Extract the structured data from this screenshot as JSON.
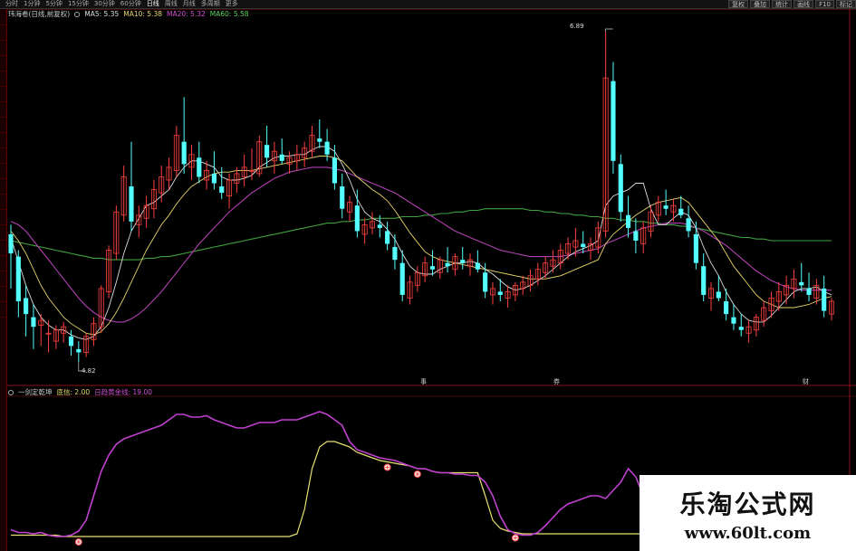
{
  "toolbar": {
    "period_tabs": [
      "分时",
      "1分钟",
      "5分钟",
      "15分钟",
      "30分钟",
      "60分钟",
      "日线",
      "周线",
      "月线",
      "多周期",
      "更多"
    ],
    "active_tab": "日线",
    "right_tabs": [
      "复权",
      "叠加",
      "统计",
      "画线",
      "F10",
      "标记"
    ]
  },
  "main_panel": {
    "stock_name": "玮海卷(日线,前复权)",
    "ma_labels": [
      {
        "text": "MA5: 5.35",
        "color": "#dddddd"
      },
      {
        "text": "MA10: 5.38",
        "color": "#e6d36a"
      },
      {
        "text": "MA20: 5.32",
        "color": "#d050d0"
      },
      {
        "text": "MA60: 5.58",
        "color": "#5fcf5f"
      }
    ],
    "high_label": "6.89",
    "low_label": "4.82"
  },
  "events": [
    "事",
    "券",
    "财"
  ],
  "indicator_panel": {
    "name": "一剑定乾坤",
    "params": "底信: 2.00",
    "line_label": "日趋黄金线: 19.00"
  },
  "watermark": {
    "title": "乐淘公式网",
    "url": "www.60lt.com"
  },
  "colors": {
    "up": "#ff4040",
    "down": "#54ffff",
    "ma5": "#dddddd",
    "ma10": "#e6d36a",
    "ma20": "#b040b0",
    "ma60": "#40a040",
    "ind_purple": "#c040d0",
    "ind_yellow": "#e8e070",
    "divider": "#8b1010"
  },
  "chart_data": {
    "type": "candlestick",
    "price_range": [
      4.82,
      6.89
    ],
    "candles": [
      [
        5.62,
        5.68,
        5.28,
        5.5
      ],
      [
        5.48,
        5.52,
        5.1,
        5.2
      ],
      [
        5.22,
        5.3,
        4.98,
        5.12
      ],
      [
        5.1,
        5.18,
        4.9,
        5.04
      ],
      [
        5.05,
        5.12,
        4.92,
        5.08
      ],
      [
        5.0,
        5.08,
        4.88,
        5.0
      ],
      [
        4.95,
        5.05,
        4.9,
        5.02
      ],
      [
        5.0,
        5.07,
        4.94,
        5.04
      ],
      [
        4.98,
        5.02,
        4.86,
        4.92
      ],
      [
        4.9,
        4.95,
        4.82,
        4.88
      ],
      [
        4.88,
        5.0,
        4.85,
        4.98
      ],
      [
        4.96,
        5.1,
        4.92,
        5.06
      ],
      [
        5.04,
        5.3,
        5.0,
        5.28
      ],
      [
        5.26,
        5.55,
        5.22,
        5.52
      ],
      [
        5.5,
        5.8,
        5.46,
        5.76
      ],
      [
        5.74,
        6.05,
        5.7,
        5.98
      ],
      [
        5.92,
        6.2,
        5.64,
        5.7
      ],
      [
        5.68,
        5.8,
        5.6,
        5.74
      ],
      [
        5.72,
        5.86,
        5.66,
        5.8
      ],
      [
        5.78,
        5.96,
        5.72,
        5.9
      ],
      [
        5.88,
        6.05,
        5.82,
        5.98
      ],
      [
        5.96,
        6.1,
        5.9,
        6.04
      ],
      [
        6.02,
        6.3,
        5.98,
        6.24
      ],
      [
        6.2,
        6.48,
        6.0,
        6.06
      ],
      [
        6.04,
        6.18,
        5.96,
        6.12
      ],
      [
        6.1,
        6.2,
        5.94,
        5.98
      ],
      [
        5.96,
        6.08,
        5.9,
        6.02
      ],
      [
        6.0,
        6.14,
        5.9,
        5.94
      ],
      [
        5.92,
        6.04,
        5.84,
        5.88
      ],
      [
        5.86,
        6.0,
        5.78,
        5.96
      ],
      [
        5.94,
        6.04,
        5.88,
        6.0
      ],
      [
        5.98,
        6.12,
        5.92,
        6.04
      ],
      [
        6.02,
        6.16,
        5.96,
        6.02
      ],
      [
        6.0,
        6.24,
        5.98,
        6.2
      ],
      [
        6.18,
        6.3,
        6.04,
        6.1
      ],
      [
        6.08,
        6.2,
        6.0,
        6.14
      ],
      [
        6.12,
        6.22,
        6.06,
        6.08
      ],
      [
        6.06,
        6.14,
        6.0,
        6.1
      ],
      [
        6.08,
        6.18,
        6.02,
        6.12
      ],
      [
        6.1,
        6.2,
        6.04,
        6.16
      ],
      [
        6.14,
        6.3,
        6.1,
        6.24
      ],
      [
        6.22,
        6.34,
        6.16,
        6.2
      ],
      [
        6.2,
        6.28,
        6.08,
        6.12
      ],
      [
        6.1,
        6.18,
        5.9,
        5.94
      ],
      [
        5.92,
        6.0,
        5.72,
        5.78
      ],
      [
        5.76,
        5.86,
        5.7,
        5.82
      ],
      [
        5.8,
        5.9,
        5.6,
        5.64
      ],
      [
        5.62,
        5.72,
        5.56,
        5.68
      ],
      [
        5.66,
        5.76,
        5.62,
        5.7
      ],
      [
        5.68,
        5.74,
        5.6,
        5.66
      ],
      [
        5.64,
        5.7,
        5.52,
        5.56
      ],
      [
        5.54,
        5.62,
        5.4,
        5.46
      ],
      [
        5.44,
        5.52,
        5.2,
        5.24
      ],
      [
        5.22,
        5.36,
        5.18,
        5.32
      ],
      [
        5.3,
        5.42,
        5.26,
        5.38
      ],
      [
        5.36,
        5.48,
        5.32,
        5.44
      ],
      [
        5.42,
        5.52,
        5.36,
        5.4
      ],
      [
        5.38,
        5.48,
        5.34,
        5.46
      ],
      [
        5.44,
        5.54,
        5.38,
        5.42
      ],
      [
        5.4,
        5.5,
        5.36,
        5.48
      ],
      [
        5.46,
        5.54,
        5.4,
        5.44
      ],
      [
        5.42,
        5.5,
        5.36,
        5.46
      ],
      [
        5.44,
        5.52,
        5.38,
        5.4
      ],
      [
        5.38,
        5.44,
        5.22,
        5.26
      ],
      [
        5.24,
        5.32,
        5.18,
        5.28
      ],
      [
        5.26,
        5.34,
        5.2,
        5.24
      ],
      [
        5.22,
        5.3,
        5.16,
        5.26
      ],
      [
        5.24,
        5.32,
        5.2,
        5.3
      ],
      [
        5.28,
        5.36,
        5.24,
        5.32
      ],
      [
        5.3,
        5.4,
        5.26,
        5.36
      ],
      [
        5.34,
        5.44,
        5.3,
        5.4
      ],
      [
        5.38,
        5.48,
        5.34,
        5.44
      ],
      [
        5.42,
        5.52,
        5.38,
        5.46
      ],
      [
        5.44,
        5.56,
        5.4,
        5.52
      ],
      [
        5.5,
        5.6,
        5.46,
        5.56
      ],
      [
        5.54,
        5.66,
        5.48,
        5.58
      ],
      [
        5.56,
        5.64,
        5.5,
        5.54
      ],
      [
        5.52,
        5.6,
        5.46,
        5.56
      ],
      [
        5.54,
        5.7,
        5.5,
        5.66
      ],
      [
        5.64,
        6.89,
        5.6,
        6.6
      ],
      [
        6.58,
        6.7,
        6.0,
        6.08
      ],
      [
        6.06,
        6.12,
        5.7,
        5.76
      ],
      [
        5.74,
        5.86,
        5.6,
        5.66
      ],
      [
        5.64,
        5.72,
        5.5,
        5.58
      ],
      [
        5.56,
        5.7,
        5.5,
        5.66
      ],
      [
        5.64,
        5.8,
        5.6,
        5.76
      ],
      [
        5.74,
        5.86,
        5.7,
        5.82
      ],
      [
        5.8,
        5.9,
        5.74,
        5.78
      ],
      [
        5.76,
        5.84,
        5.7,
        5.8
      ],
      [
        5.78,
        5.86,
        5.72,
        5.74
      ],
      [
        5.72,
        5.8,
        5.6,
        5.64
      ],
      [
        5.62,
        5.7,
        5.4,
        5.44
      ],
      [
        5.42,
        5.5,
        5.2,
        5.24
      ],
      [
        5.22,
        5.32,
        5.14,
        5.28
      ],
      [
        5.26,
        5.36,
        5.2,
        5.22
      ],
      [
        5.2,
        5.28,
        5.08,
        5.12
      ],
      [
        5.1,
        5.18,
        5.02,
        5.06
      ],
      [
        5.04,
        5.12,
        4.98,
        5.02
      ],
      [
        5.0,
        5.08,
        4.94,
        5.04
      ],
      [
        5.02,
        5.12,
        4.98,
        5.1
      ],
      [
        5.08,
        5.2,
        5.04,
        5.16
      ],
      [
        5.14,
        5.26,
        5.1,
        5.22
      ],
      [
        5.2,
        5.32,
        5.14,
        5.26
      ],
      [
        5.24,
        5.36,
        5.18,
        5.3
      ],
      [
        5.28,
        5.4,
        5.22,
        5.34
      ],
      [
        5.32,
        5.44,
        5.26,
        5.3
      ],
      [
        5.28,
        5.38,
        5.2,
        5.24
      ],
      [
        5.22,
        5.34,
        5.18,
        5.3
      ],
      [
        5.28,
        5.36,
        5.1,
        5.14
      ],
      [
        5.12,
        5.22,
        5.08,
        5.2
      ]
    ],
    "ma5": [
      5.6,
      5.45,
      5.3,
      5.18,
      5.1,
      5.05,
      5.02,
      5.02,
      4.99,
      4.97,
      4.96,
      4.98,
      5.04,
      5.16,
      5.32,
      5.5,
      5.64,
      5.72,
      5.8,
      5.82,
      5.86,
      5.9,
      5.98,
      6.04,
      6.08,
      6.08,
      6.06,
      6.04,
      5.98,
      5.96,
      5.96,
      5.97,
      5.99,
      6.04,
      6.07,
      6.1,
      6.11,
      6.11,
      6.12,
      6.12,
      6.15,
      6.17,
      6.17,
      6.14,
      6.06,
      5.96,
      5.84,
      5.76,
      5.72,
      5.7,
      5.65,
      5.59,
      5.5,
      5.42,
      5.38,
      5.37,
      5.37,
      5.4,
      5.42,
      5.44,
      5.44,
      5.45,
      5.44,
      5.4,
      5.37,
      5.33,
      5.29,
      5.27,
      5.28,
      5.3,
      5.33,
      5.36,
      5.4,
      5.44,
      5.48,
      5.51,
      5.53,
      5.55,
      5.58,
      5.8,
      5.86,
      5.88,
      5.9,
      5.94,
      5.94,
      5.78,
      5.68,
      5.68,
      5.72,
      5.76,
      5.74,
      5.66,
      5.54,
      5.44,
      5.36,
      5.26,
      5.18,
      5.12,
      5.08,
      5.07,
      5.07,
      5.11,
      5.16,
      5.21,
      5.26,
      5.28,
      5.28,
      5.29,
      5.26,
      5.24
    ],
    "ma10": [
      5.64,
      5.58,
      5.5,
      5.4,
      5.3,
      5.22,
      5.16,
      5.1,
      5.06,
      5.03,
      5.0,
      4.99,
      5.01,
      5.06,
      5.13,
      5.22,
      5.32,
      5.42,
      5.52,
      5.6,
      5.68,
      5.74,
      5.81,
      5.87,
      5.92,
      5.95,
      5.98,
      6.0,
      6.01,
      6.01,
      6.02,
      6.02,
      6.02,
      6.03,
      6.04,
      6.05,
      6.06,
      6.07,
      6.08,
      6.09,
      6.1,
      6.11,
      6.11,
      6.1,
      6.08,
      6.03,
      5.98,
      5.94,
      5.9,
      5.87,
      5.83,
      5.77,
      5.7,
      5.63,
      5.57,
      5.51,
      5.48,
      5.46,
      5.45,
      5.44,
      5.43,
      5.42,
      5.41,
      5.4,
      5.39,
      5.38,
      5.37,
      5.36,
      5.35,
      5.34,
      5.34,
      5.34,
      5.35,
      5.36,
      5.38,
      5.4,
      5.42,
      5.44,
      5.46,
      5.56,
      5.62,
      5.66,
      5.7,
      5.74,
      5.77,
      5.8,
      5.82,
      5.83,
      5.84,
      5.85,
      5.82,
      5.76,
      5.7,
      5.64,
      5.58,
      5.5,
      5.42,
      5.36,
      5.3,
      5.24,
      5.2,
      5.18,
      5.16,
      5.16,
      5.16,
      5.17,
      5.18,
      5.2,
      5.22,
      5.23
    ],
    "ma20": [
      5.7,
      5.68,
      5.64,
      5.58,
      5.52,
      5.46,
      5.4,
      5.34,
      5.28,
      5.22,
      5.17,
      5.13,
      5.1,
      5.08,
      5.07,
      5.07,
      5.09,
      5.12,
      5.16,
      5.21,
      5.26,
      5.32,
      5.38,
      5.44,
      5.5,
      5.56,
      5.61,
      5.66,
      5.71,
      5.76,
      5.8,
      5.84,
      5.88,
      5.91,
      5.94,
      5.97,
      5.99,
      6.01,
      6.02,
      6.03,
      6.04,
      6.04,
      6.04,
      6.03,
      6.02,
      6.0,
      5.98,
      5.96,
      5.94,
      5.92,
      5.9,
      5.88,
      5.85,
      5.82,
      5.79,
      5.76,
      5.73,
      5.7,
      5.67,
      5.64,
      5.62,
      5.6,
      5.58,
      5.56,
      5.54,
      5.52,
      5.51,
      5.5,
      5.49,
      5.48,
      5.48,
      5.48,
      5.48,
      5.48,
      5.49,
      5.5,
      5.51,
      5.52,
      5.53,
      5.56,
      5.58,
      5.6,
      5.62,
      5.64,
      5.66,
      5.67,
      5.68,
      5.69,
      5.69,
      5.69,
      5.68,
      5.66,
      5.64,
      5.61,
      5.58,
      5.55,
      5.51,
      5.47,
      5.43,
      5.39,
      5.36,
      5.33,
      5.31,
      5.29,
      5.28,
      5.27,
      5.27,
      5.27,
      5.27,
      5.27
    ],
    "ma60": [
      5.58,
      5.57,
      5.56,
      5.55,
      5.54,
      5.53,
      5.52,
      5.51,
      5.5,
      5.49,
      5.48,
      5.47,
      5.47,
      5.46,
      5.46,
      5.46,
      5.46,
      5.46,
      5.47,
      5.47,
      5.48,
      5.48,
      5.49,
      5.5,
      5.51,
      5.52,
      5.53,
      5.54,
      5.55,
      5.56,
      5.57,
      5.58,
      5.59,
      5.6,
      5.61,
      5.62,
      5.63,
      5.64,
      5.65,
      5.66,
      5.67,
      5.68,
      5.69,
      5.69,
      5.7,
      5.7,
      5.71,
      5.71,
      5.72,
      5.72,
      5.72,
      5.72,
      5.73,
      5.73,
      5.73,
      5.74,
      5.74,
      5.75,
      5.75,
      5.76,
      5.76,
      5.77,
      5.77,
      5.78,
      5.78,
      5.78,
      5.78,
      5.78,
      5.78,
      5.77,
      5.77,
      5.76,
      5.76,
      5.75,
      5.75,
      5.74,
      5.74,
      5.73,
      5.73,
      5.72,
      5.72,
      5.71,
      5.71,
      5.7,
      5.7,
      5.69,
      5.69,
      5.68,
      5.68,
      5.67,
      5.67,
      5.66,
      5.65,
      5.64,
      5.63,
      5.62,
      5.61,
      5.6,
      5.6,
      5.59,
      5.59,
      5.58,
      5.58,
      5.58,
      5.58,
      5.58,
      5.58,
      5.58,
      5.58,
      5.58
    ],
    "indicator": {
      "purple": [
        5,
        3,
        3,
        2,
        3,
        1,
        0,
        0,
        1,
        4,
        12,
        30,
        48,
        60,
        68,
        72,
        74,
        76,
        78,
        80,
        82,
        86,
        90,
        90,
        88,
        88,
        89,
        86,
        84,
        82,
        80,
        80,
        82,
        84,
        84,
        84,
        86,
        86,
        86,
        88,
        90,
        92,
        90,
        86,
        82,
        70,
        64,
        62,
        60,
        58,
        57,
        56,
        54,
        52,
        50,
        50,
        48,
        47,
        47,
        46,
        46,
        45,
        45,
        40,
        30,
        15,
        5,
        2,
        1,
        1,
        3,
        8,
        14,
        20,
        24,
        26,
        28,
        30,
        30,
        28,
        34,
        40,
        50,
        44,
        30,
        32,
        34,
        36,
        34,
        32,
        30,
        26,
        22,
        20,
        18,
        16,
        16,
        18,
        18,
        20,
        22,
        22,
        22,
        22,
        24,
        24,
        24,
        24,
        24,
        24
      ],
      "yellow": [
        1,
        1,
        1,
        1,
        1,
        1,
        1,
        0,
        0,
        0,
        0,
        0,
        0,
        0,
        0,
        0,
        0,
        0,
        0,
        0,
        0,
        0,
        0,
        0,
        0,
        0,
        0,
        0,
        0,
        0,
        0,
        0,
        0,
        0,
        0,
        0,
        0,
        0,
        2,
        20,
        50,
        66,
        70,
        70,
        68,
        66,
        62,
        60,
        58,
        56,
        55,
        54,
        53,
        52,
        50,
        50,
        48,
        47,
        47,
        47,
        47,
        47,
        47,
        30,
        12,
        6,
        4,
        3,
        2,
        2,
        2,
        2,
        2,
        2,
        2,
        2,
        2,
        2,
        2,
        2,
        2,
        2,
        2,
        2,
        2,
        2,
        2,
        2,
        2,
        2,
        2,
        2,
        2,
        2,
        2,
        2,
        2,
        2,
        2,
        2,
        2,
        2,
        2,
        2,
        2,
        2,
        2,
        2,
        2,
        2
      ],
      "signals": [
        9,
        50,
        54,
        67
      ]
    }
  }
}
